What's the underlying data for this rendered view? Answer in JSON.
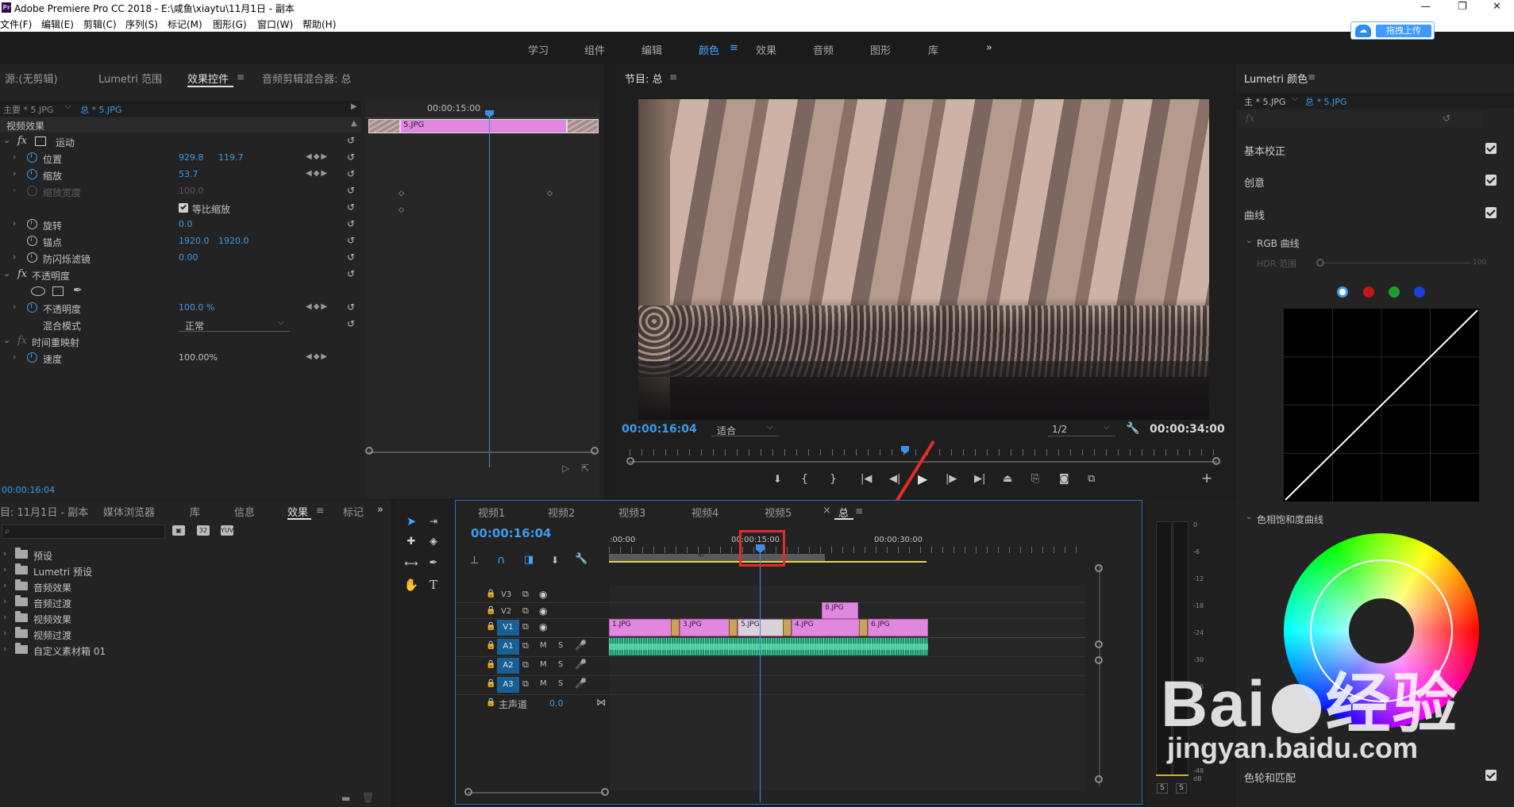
{
  "window": {
    "title": "Adobe Premiere Pro CC 2018 - E:\\咸鱼\\xiaytu\\11月1日 - 副本",
    "app_icon": "Pr"
  },
  "menu": [
    "文件(F)",
    "编辑(E)",
    "剪辑(C)",
    "序列(S)",
    "标记(M)",
    "图形(G)",
    "窗口(W)",
    "帮助(H)"
  ],
  "workspaces": [
    "学习",
    "组件",
    "编辑",
    "颜色",
    "效果",
    "音频",
    "图形",
    "库"
  ],
  "workspace_active": "颜色",
  "workspace_more": "»",
  "upload_button": "拖拽上传",
  "source_panel": {
    "tabs": [
      "源:(无剪辑)",
      "Lumetri 范围",
      "效果控件",
      "音频剪辑混合器: 总"
    ],
    "master_label": "主要 * 5.JPG",
    "clip_label": "总 * 5.JPG",
    "timecode": "00:00:15:00",
    "mini_clip": "5.JPG",
    "section": "视频效果",
    "footer_timecode": "00:00:16:04",
    "groups": {
      "motion": "运动",
      "opacity": "不透明度",
      "time_remap": "时间重映射"
    },
    "props": {
      "position": {
        "label": "位置",
        "v1": "929.8",
        "v2": "119.7"
      },
      "scale": {
        "label": "缩放",
        "v1": "53.7"
      },
      "scale_width": {
        "label": "缩放宽度",
        "v1": "100.0"
      },
      "uniform": "等比缩放",
      "rotation": {
        "label": "旋转",
        "v1": "0.0"
      },
      "anchor": {
        "label": "锚点",
        "v1": "1920.0",
        "v2": "1920.0"
      },
      "flicker": {
        "label": "防闪烁滤镜",
        "v1": "0.00"
      },
      "opacity": {
        "label": "不透明度",
        "v1": "100.0 %"
      },
      "blend": {
        "label": "混合模式",
        "v1": "正常"
      },
      "speed": {
        "label": "速度",
        "v1": "100.00%"
      }
    }
  },
  "program": {
    "title": "节目: 总",
    "timecode": "00:00:16:04",
    "fit": "适合",
    "quality": "1/2",
    "duration": "00:00:34:00"
  },
  "project": {
    "tabs": [
      "目: 11月1日 - 副本",
      "媒体浏览器",
      "库",
      "信息",
      "效果",
      "标记"
    ],
    "active_tab": "效果",
    "items": [
      "预设",
      "Lumetri 预设",
      "音频效果",
      "音频过渡",
      "视频效果",
      "视频过渡",
      "自定义素材箱 01"
    ]
  },
  "timeline": {
    "tabs": [
      "视频1",
      "视频2",
      "视频3",
      "视频4",
      "视频5",
      "总"
    ],
    "active_tab": "总",
    "timecode": "00:00:16:04",
    "ruler": [
      ":00:00",
      "00:00:15:00",
      "00:00:30:00"
    ],
    "video_tracks": [
      "V3",
      "V2",
      "V1"
    ],
    "audio_tracks": [
      "A1",
      "A2",
      "A3"
    ],
    "master": {
      "label": "主声道",
      "value": "0.0"
    },
    "clips_v1": [
      "1.JPG",
      "3.JPG",
      "5.JPG",
      "4.JPG",
      "6.JPG"
    ],
    "clips_v2": [
      "8.JPG"
    ],
    "mute": "M",
    "solo": "S",
    "work_area_mark": "III"
  },
  "meters": {
    "scale": [
      "0",
      "-6",
      "-12",
      "-18",
      "-24",
      "-30",
      "-36",
      "-42",
      "-48",
      "dB"
    ],
    "solo": [
      "S",
      "S"
    ]
  },
  "lumetri": {
    "title": "Lumetri 颜色",
    "master_label": "主 * 5.JPG",
    "clip_label": "总 * 5.JPG",
    "fx": "fx",
    "sections": [
      "基本校正",
      "创意",
      "曲线"
    ],
    "rgb_curve": "RGB 曲线",
    "hdr": "HDR 范围",
    "hdr_value": "100",
    "hue_sat": "色相饱和度曲线",
    "bottom": "色轮和匹配",
    "swatch_colors": [
      "#ffffff",
      "#c01818",
      "#1f9d2c",
      "#1b3fd8"
    ]
  },
  "watermark": {
    "brand": "Bai",
    "brand2": "经验",
    "url": "jingyan.baidu.com"
  }
}
